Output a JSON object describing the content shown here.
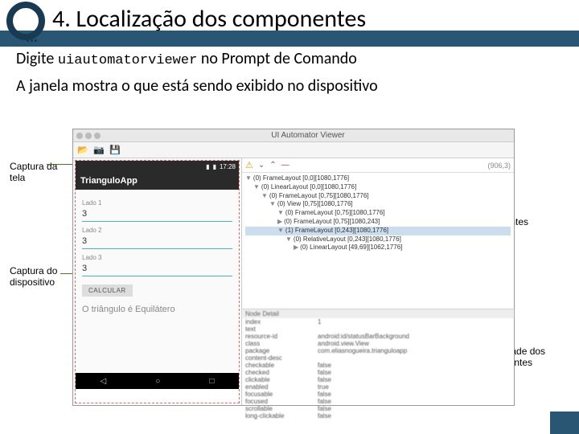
{
  "slide": {
    "title": "4. Localização dos componentes",
    "line1_a": "Digite ",
    "line1_code": "uiautomatorviewer",
    "line1_b": " no Prompt de Comando",
    "line2": "A janela mostra o que está sendo exibido no dispositivo"
  },
  "callouts": {
    "capture_screen": "Captura da tela",
    "capture_device": "Captura do dispositivo",
    "tree": "Árvore de componentes",
    "props": "Propriedade dos componentes"
  },
  "window": {
    "title": "UI Automator Viewer",
    "coords": "(906,3)"
  },
  "device": {
    "time": "17:28",
    "app_name": "TrianguloApp",
    "label1": "Lado 1",
    "val1": "3",
    "label2": "Lado 2",
    "val2": "3",
    "label3": "Lado 3",
    "val3": "3",
    "button": "CALCULAR",
    "result": "O triângulo é Equilátero"
  },
  "tree": {
    "n0": "(0) FrameLayout [0,0][1080,1776]",
    "n1": "(0) LinearLayout [0,0][1080,1776]",
    "n2": "(0) FrameLayout [0,75][1080,1776]",
    "n3": "(0) View [0,75][1080,1776]",
    "n4": "(0) FrameLayout [0,75][1080,1776]",
    "n5": "(0) FrameLayout [0,75][1080,243]",
    "n6": "(1) FrameLayout [0,243][1080,1776]",
    "n7": "(0) RelativeLayout [0,243][1080,1776]",
    "n8": "(0) LinearLayout [49,69][1062,1776]"
  },
  "details": {
    "header": "Node Detail",
    "r0k": "index",
    "r0v": "1",
    "r1k": "text",
    "r1v": "",
    "r2k": "resource-id",
    "r2v": "android:id/statusBarBackground",
    "r3k": "class",
    "r3v": "android.view.View",
    "r4k": "package",
    "r4v": "com.eliasnogueira.trianguloapp",
    "r5k": "content-desc",
    "r5v": "",
    "r6k": "checkable",
    "r6v": "false",
    "r7k": "checked",
    "r7v": "false",
    "r8k": "clickable",
    "r8v": "false",
    "r9k": "enabled",
    "r9v": "true",
    "r10k": "focusable",
    "r10v": "false",
    "r11k": "focused",
    "r11v": "false",
    "r12k": "scrollable",
    "r12v": "false",
    "r13k": "long-clickable",
    "r13v": "false"
  }
}
